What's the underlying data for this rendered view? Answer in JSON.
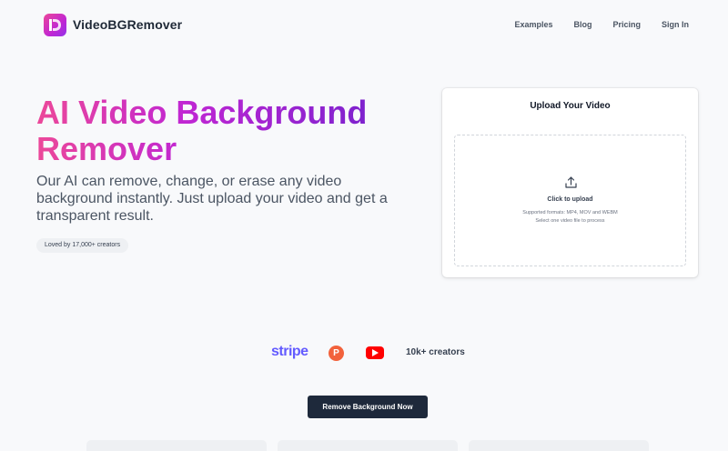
{
  "header": {
    "brand": "VideoBGRemover",
    "nav": [
      "Examples",
      "Blog",
      "Pricing",
      "Sign In"
    ]
  },
  "hero": {
    "title_line1": "AI Video Background",
    "title_line2": "Remover",
    "description": "Our AI can remove, change, or erase any video background instantly. Just upload your video and get a transparent result.",
    "badge": "Loved by 17,000+ creators"
  },
  "upload": {
    "title": "Upload Your Video",
    "click_label": "Click to upload",
    "formats": "Supported formats: MP4, MOV and WEBM",
    "note": "Select one video file to process"
  },
  "proof": {
    "stripe": "stripe",
    "producthunt": "P",
    "creators": "10k+ creators"
  },
  "cta": {
    "label": "Remove Background Now"
  },
  "colors": {
    "accent_start": "#ec4899",
    "accent_end": "#7e22ce",
    "cta_bg": "#1e293b",
    "stripe": "#635bff",
    "producthunt": "#f2623c",
    "youtube": "#ff0000"
  },
  "icons": [
    "logo-icon",
    "upload-icon",
    "stripe-logo",
    "producthunt-logo",
    "youtube-logo"
  ]
}
